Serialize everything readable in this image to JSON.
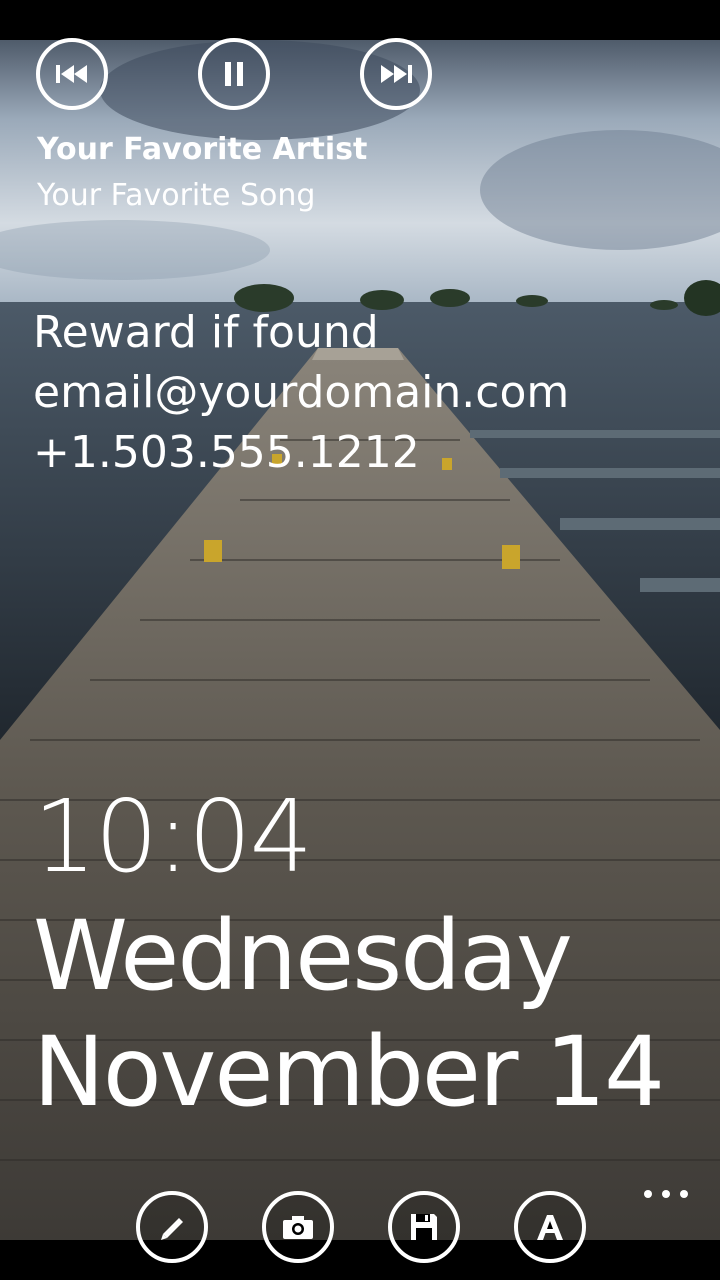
{
  "media": {
    "artist": "Your Favorite Artist",
    "song": "Your Favorite Song",
    "controls": [
      "previous-icon",
      "pause-icon",
      "next-icon"
    ]
  },
  "owner_info": {
    "line1": "Reward if found",
    "line2": "email@yourdomain.com",
    "line3": "+1.503.555.1212"
  },
  "clock": {
    "time": "10:04",
    "day": "Wednesday",
    "date": "November 14"
  },
  "app_bar": {
    "buttons": [
      "pencil-icon",
      "camera-icon",
      "save-icon",
      "font-icon"
    ],
    "more": "ellipsis-icon"
  },
  "colors": {
    "foreground": "#ffffff",
    "bars": "#000000"
  }
}
